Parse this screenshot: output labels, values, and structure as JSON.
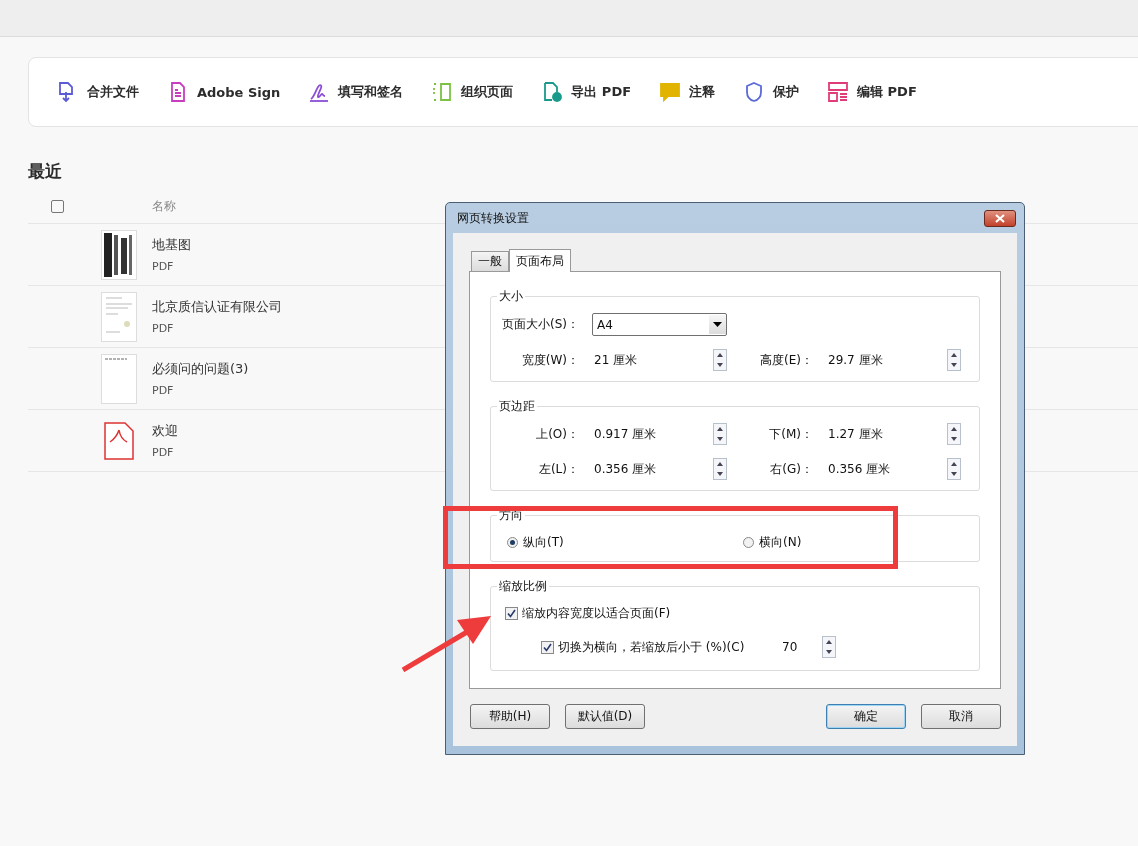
{
  "toolbar": [
    {
      "kind": "combine",
      "label": "合并文件"
    },
    {
      "kind": "sign",
      "label": "Adobe Sign"
    },
    {
      "kind": "fill",
      "label": "填写和签名"
    },
    {
      "kind": "organize",
      "label": "组织页面"
    },
    {
      "kind": "export",
      "label": "导出 PDF"
    },
    {
      "kind": "comment",
      "label": "注释"
    },
    {
      "kind": "protect",
      "label": "保护"
    },
    {
      "kind": "edit",
      "label": "编辑 PDF"
    }
  ],
  "recent": {
    "title": "最近",
    "select_all": {
      "checked": false
    },
    "column": "名称",
    "files": [
      {
        "kind": "drawing",
        "name": "地基图",
        "type": "PDF"
      },
      {
        "kind": "letter",
        "name": "北京质信认证有限公司",
        "type": "PDF"
      },
      {
        "kind": "blank",
        "name": "必须问的问题(3)",
        "type": "PDF"
      },
      {
        "kind": "pdf",
        "name": "欢迎",
        "type": "PDF"
      }
    ]
  },
  "dialog": {
    "title": "网页转换设置",
    "tabs": [
      {
        "label": "一般",
        "selected": false
      },
      {
        "label": "页面布局",
        "selected": true
      }
    ],
    "size": {
      "title": "大小",
      "page_size_label": "页面大小(S)：",
      "page_size": "A4",
      "width_label": "宽度(W)：",
      "width": "21 厘米",
      "height_label": "高度(E)：",
      "height": "29.7 厘米"
    },
    "margins": {
      "title": "页边距",
      "top_label": "上(O)：",
      "top": "0.917 厘米",
      "bottom_label": "下(M)：",
      "bottom": "1.27 厘米",
      "left_label": "左(L)：",
      "left": "0.356 厘米",
      "right_label": "右(G)：",
      "right": "0.356 厘米"
    },
    "orientation": {
      "title": "方向",
      "options": [
        {
          "label": "纵向(T)",
          "selected": true
        },
        {
          "label": "横向(N)",
          "selected": false
        }
      ]
    },
    "scale": {
      "title": "缩放比例",
      "fit": {
        "label": "缩放内容宽度以适合页面(F)",
        "checked": true
      },
      "switch": {
        "label": "切换为横向，若缩放后小于 (%)(C)",
        "checked": true
      },
      "percent": "70"
    },
    "buttons": [
      {
        "label": "帮助(H)",
        "default": false
      },
      {
        "label": "默认值(D)",
        "default": false
      },
      {
        "label": "确定",
        "default": true
      },
      {
        "label": "取消",
        "default": false
      }
    ]
  }
}
